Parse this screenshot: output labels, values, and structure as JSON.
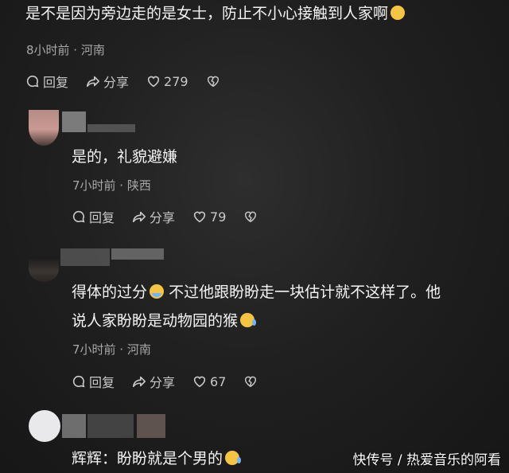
{
  "comments": [
    {
      "text": "是不是因为旁边走的是女士，防止不小心接触到人家啊",
      "emoji": "flushed-face",
      "meta": "8小时前 · 河南",
      "reply_label": "回复",
      "share_label": "分享",
      "likes": "279"
    },
    {
      "text": "是的，礼貌避嫌",
      "meta": "7小时前 · 陕西",
      "reply_label": "回复",
      "share_label": "分享",
      "likes": "79"
    },
    {
      "text_line1": "得体的过分",
      "emoji1": "cold-sweat-face",
      "text_line1b": "不过他跟盼盼走一块估计就不这样了。他",
      "text_line2": "说人家盼盼是动物园的猴",
      "emoji2": "rolling-laughing-face",
      "meta": "7小时前 · 河南",
      "reply_label": "回复",
      "share_label": "分享",
      "likes": "67"
    },
    {
      "text": "辉辉：盼盼就是个男的",
      "emoji": "rolling-laughing-face"
    }
  ],
  "watermark": "快传号 / 热爱音乐的阿看"
}
